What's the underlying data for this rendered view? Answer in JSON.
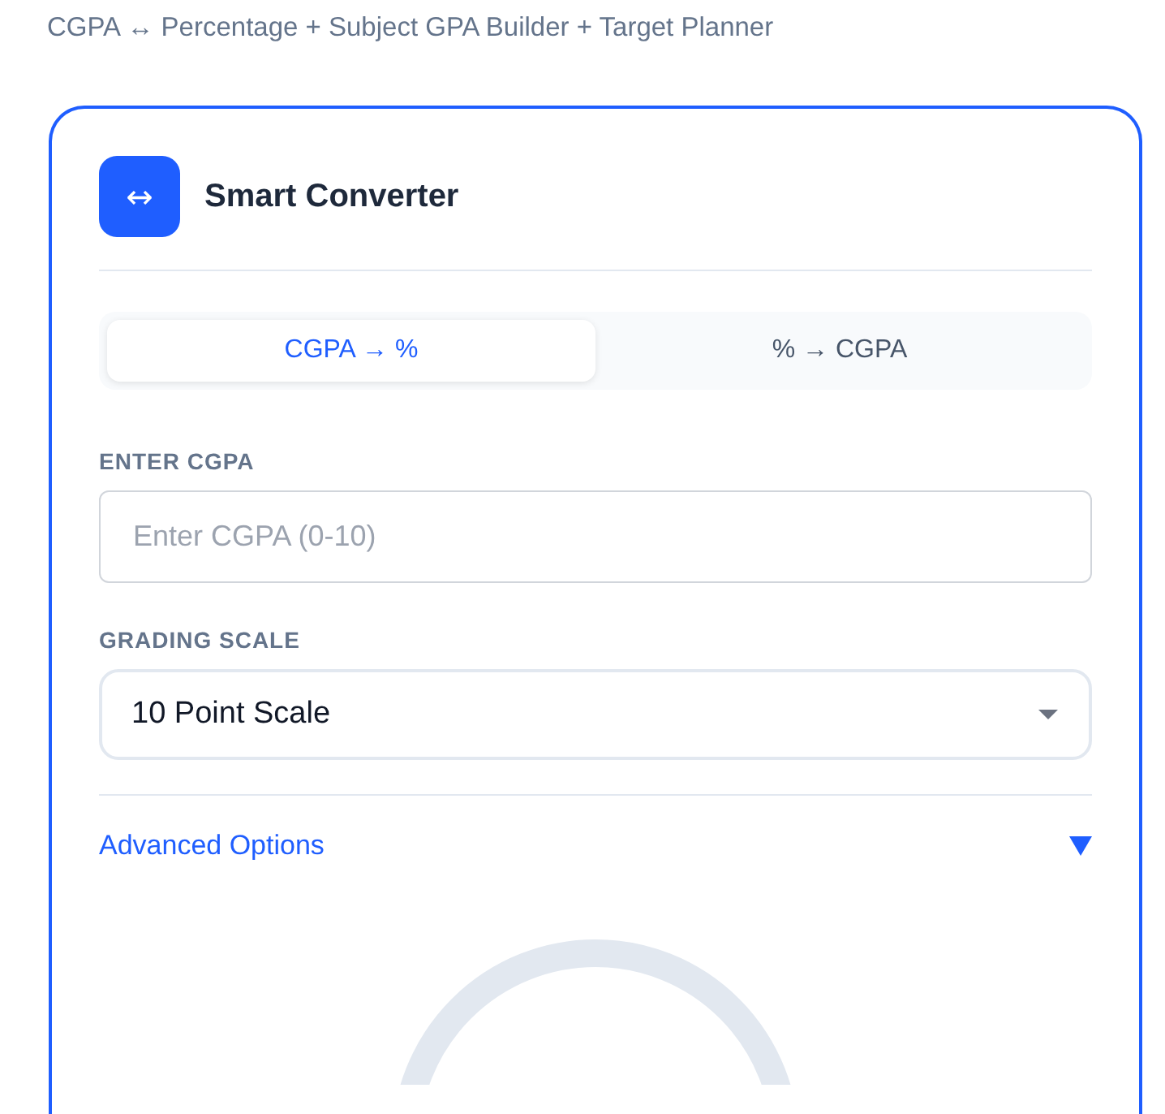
{
  "subtitle": "CGPA ↔ Percentage + Subject GPA Builder + Target Planner",
  "card": {
    "icon": "↔",
    "title": "Smart Converter"
  },
  "tabs": [
    {
      "label": "CGPA → %",
      "selected": true
    },
    {
      "label": "% → CGPA",
      "selected": false
    }
  ],
  "cgpa_field": {
    "label": "ENTER CGPA",
    "placeholder": "Enter CGPA (0-10)"
  },
  "scale_field": {
    "label": "GRADING SCALE",
    "value": "10 Point Scale"
  },
  "advanced": {
    "label": "Advanced Options",
    "expanded": false
  }
}
